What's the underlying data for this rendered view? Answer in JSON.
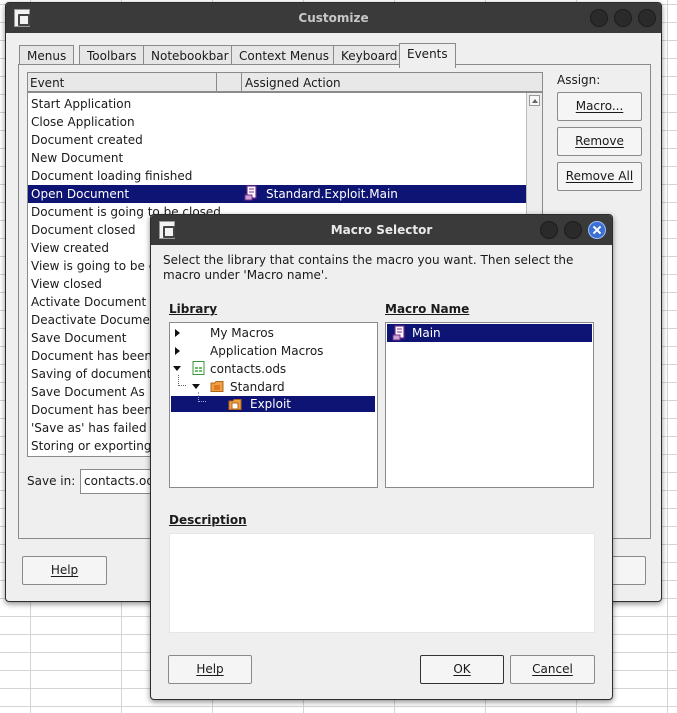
{
  "customize": {
    "title": "Customize",
    "tabs": [
      "Menus",
      "Toolbars",
      "Notebookbar",
      "Context Menus",
      "Keyboard",
      "Events"
    ],
    "active_tab": "Events",
    "columns": {
      "event": "Event",
      "action": "Assigned Action"
    },
    "events": [
      "Start Application",
      "Close Application",
      "Document created",
      "New Document",
      "Document loading finished",
      "Open Document",
      "Document is going to be closed",
      "Document closed",
      "View created",
      "View is going to be clo",
      "View closed",
      "Activate Document",
      "Deactivate Document",
      "Save Document",
      "Document has been sa",
      "Saving of document fa",
      "Save Document As",
      "Document has been sa",
      "'Save as' has failed",
      "Storing or exporting c"
    ],
    "selected_event_index": 5,
    "selected_action": "Standard.Exploit.Main",
    "assign_label": "Assign:",
    "buttons": {
      "macro": "Macro...",
      "remove": "Remove",
      "remove_all": "Remove All",
      "help": "Help"
    },
    "save_in_label": "Save in:",
    "save_in_value": "contacts.ods"
  },
  "macro_selector": {
    "title": "Macro Selector",
    "instructions": "Select the library that contains the macro you want. Then select the macro under 'Macro name'.",
    "library_label": "Library",
    "macro_name_label": "Macro Name",
    "library_tree": [
      {
        "label": "My Macros",
        "level": 0,
        "expanded": false
      },
      {
        "label": "Application Macros",
        "level": 0,
        "expanded": false
      },
      {
        "label": "contacts.ods",
        "level": 0,
        "expanded": true,
        "icon": "spreadsheet-icon"
      },
      {
        "label": "Standard",
        "level": 1,
        "expanded": true,
        "icon": "library-folder-icon"
      },
      {
        "label": "Exploit",
        "level": 2,
        "selected": true,
        "icon": "module-folder-icon"
      }
    ],
    "macros": [
      "Main"
    ],
    "selected_macro": "Main",
    "description_label": "Description",
    "description_text": "",
    "buttons": {
      "help": "Help",
      "ok": "OK",
      "cancel": "Cancel"
    }
  },
  "colors": {
    "selection": "#0d1473",
    "titlebar": "#3a3a3a",
    "accent_close": "#3b6fd4"
  }
}
